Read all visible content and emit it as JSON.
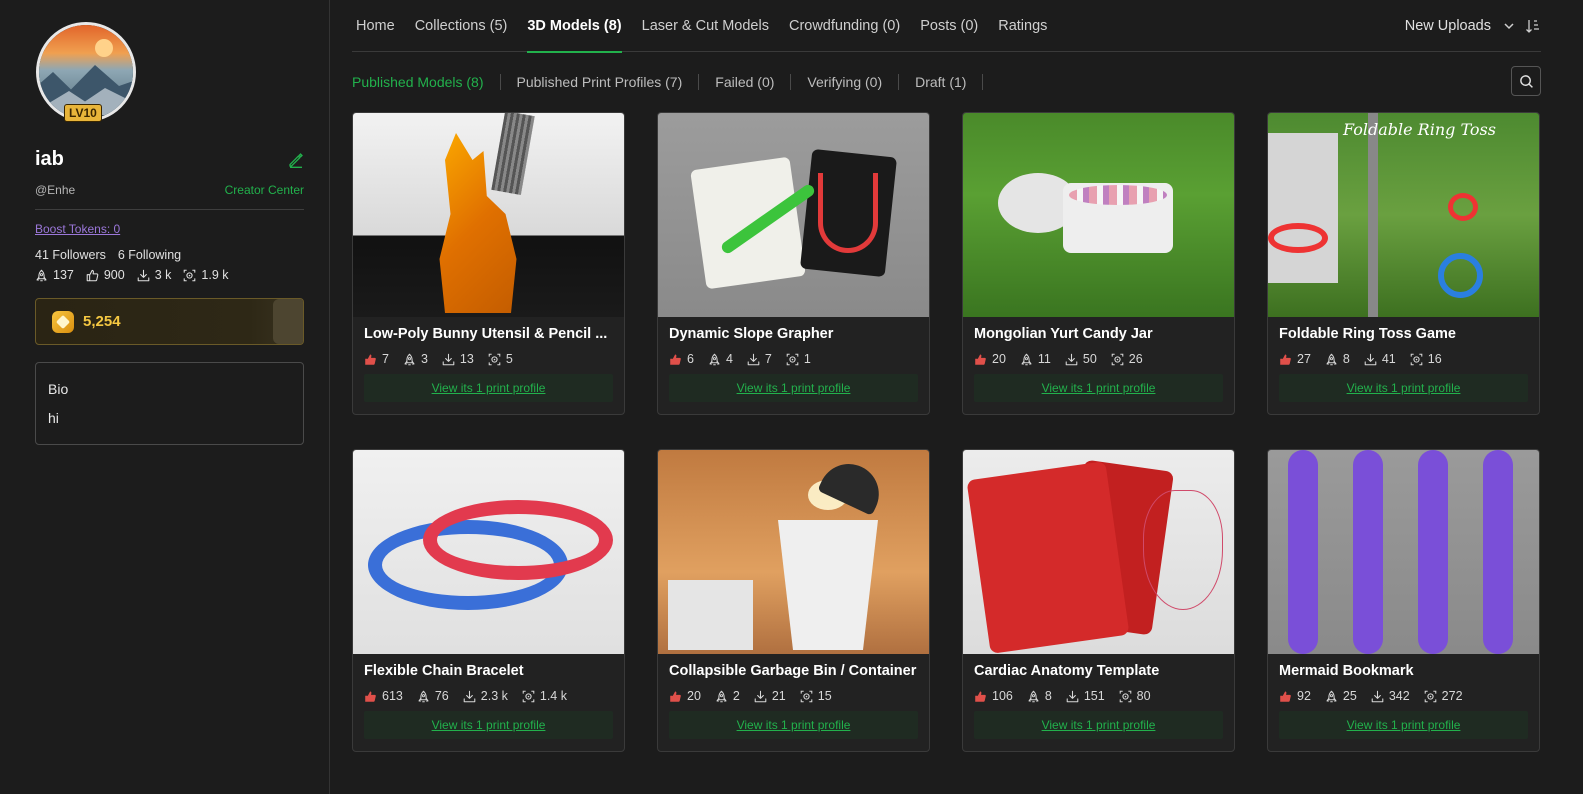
{
  "profile": {
    "level_badge": "LV10",
    "username": "iab",
    "handle": "@Enhe",
    "creator_center": "Creator Center",
    "boost_tokens": "Boost Tokens: 0",
    "followers": "41 Followers",
    "following": "6 Following",
    "stats": {
      "boosts": "137",
      "likes": "900",
      "downloads": "3 k",
      "prints": "1.9 k"
    },
    "token_balance": "5,254",
    "bio_title": "Bio",
    "bio_text": "hi"
  },
  "nav": {
    "tabs": [
      "Home",
      "Collections (5)",
      "3D Models (8)",
      "Laser & Cut Models",
      "Crowdfunding (0)",
      "Posts (0)",
      "Ratings"
    ],
    "active_tab": "3D Models (8)",
    "sort_label": "New Uploads"
  },
  "subnav": {
    "tabs": [
      "Published Models (8)",
      "Published Print Profiles (7)",
      "Failed (0)",
      "Verifying (0)",
      "Draft (1)"
    ],
    "active_tab": "Published Models (8)"
  },
  "colors": {
    "accent": "#22b14c",
    "like": "#e0504a",
    "token": "#f5c842",
    "boost_link": "#9b77d9"
  },
  "models": [
    {
      "title": "Low-Poly Bunny Utensil & Pencil ...",
      "likes": "7",
      "boosts": "3",
      "downloads": "13",
      "prints": "5",
      "link": "View its 1 print profile"
    },
    {
      "title": "Dynamic Slope Grapher",
      "likes": "6",
      "boosts": "4",
      "downloads": "7",
      "prints": "1",
      "link": "View its 1 print profile"
    },
    {
      "title": "Mongolian Yurt Candy Jar",
      "likes": "20",
      "boosts": "11",
      "downloads": "50",
      "prints": "26",
      "link": "View its 1 print profile"
    },
    {
      "title": "Foldable Ring Toss Game",
      "likes": "27",
      "boosts": "8",
      "downloads": "41",
      "prints": "16",
      "link": "View its 1 print profile",
      "image_text": "Foldable Ring Toss"
    },
    {
      "title": "Flexible Chain Bracelet",
      "likes": "613",
      "boosts": "76",
      "downloads": "2.3 k",
      "prints": "1.4 k",
      "link": "View its 1 print profile"
    },
    {
      "title": "Collapsible Garbage Bin / Container",
      "likes": "20",
      "boosts": "2",
      "downloads": "21",
      "prints": "15",
      "link": "View its 1 print profile"
    },
    {
      "title": "Cardiac Anatomy Template",
      "likes": "106",
      "boosts": "8",
      "downloads": "151",
      "prints": "80",
      "link": "View its 1 print profile"
    },
    {
      "title": "Mermaid Bookmark",
      "likes": "92",
      "boosts": "25",
      "downloads": "342",
      "prints": "272",
      "link": "View its 1 print profile"
    }
  ]
}
